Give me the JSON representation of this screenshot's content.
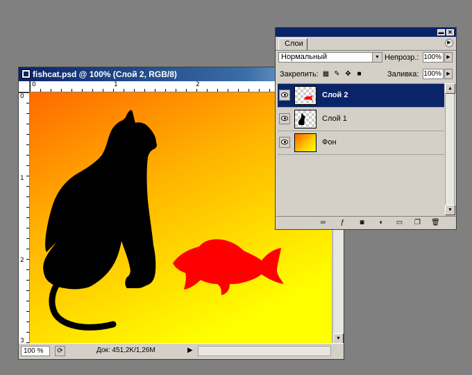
{
  "document": {
    "title": "fishcat.psd @ 100% (Слой 2, RGB/8)",
    "ruler_h_labels": [
      "0",
      "1",
      "2"
    ],
    "ruler_v_labels": [
      "0",
      "1",
      "2",
      "3"
    ],
    "zoom": "100 %",
    "doc_info": "Док: 451,2K/1,26M",
    "canvas_gradient": [
      "#ff6a00",
      "#ffb400",
      "#ffff00"
    ],
    "cat_color": "#000000",
    "fish_color": "#ff0000"
  },
  "layers_panel": {
    "tab": "Слои",
    "blend_mode": "Нормальный",
    "opacity_label": "Непрозр.:",
    "opacity_value": "100%",
    "lock_label": "Закрепить:",
    "fill_label": "Заливка:",
    "fill_value": "100%",
    "layers": [
      {
        "name": "Слой 2",
        "selected": true,
        "visible": true,
        "thumb": "fish"
      },
      {
        "name": "Слой 1",
        "selected": false,
        "visible": true,
        "thumb": "cat"
      },
      {
        "name": "Фон",
        "selected": false,
        "visible": true,
        "thumb": "background"
      }
    ]
  },
  "colors": {
    "title_active": "#0a246a",
    "panel_bg": "#d4d0c8",
    "workspace": "#808080"
  }
}
